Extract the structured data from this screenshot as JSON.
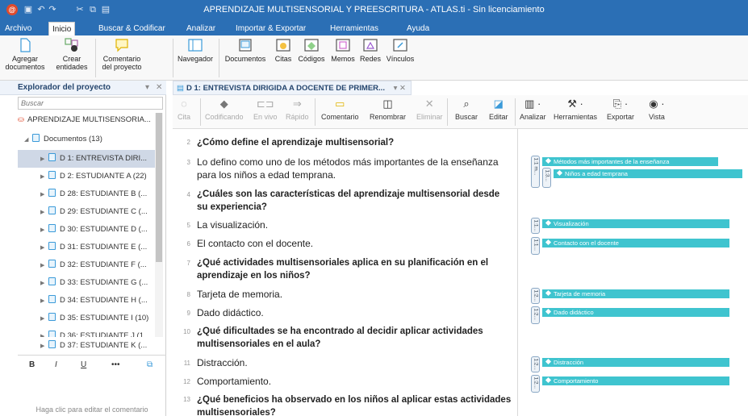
{
  "window": {
    "title": "APRENDIZAJE MULTISENSORIAL Y PREESCRITURA - ATLAS.ti - Sin licenciamiento"
  },
  "menu_tabs": [
    "Archivo",
    "Inicio",
    "Buscar & Codificar",
    "Analizar",
    "Importar & Exportar",
    "Herramientas",
    "Ayuda"
  ],
  "ribbon": {
    "add_docs": [
      "Agregar",
      "documentos"
    ],
    "create_entities": [
      "Crear",
      "entidades"
    ],
    "project_comment": [
      "Comentario",
      "del proyecto"
    ],
    "navigator": "Navegador",
    "documents": "Documentos",
    "quotes": "Citas",
    "codes": "Códigos",
    "memos": "Memos",
    "networks": "Redes",
    "links": "Vínculos"
  },
  "explorer": {
    "title": "Explorador del proyecto",
    "search_placeholder": "Buscar",
    "project": "APRENDIZAJE MULTISENSORIA...",
    "documents_group": "Documentos (13)",
    "items": [
      "D 1: ENTREVISTA DIRI...",
      "D 2: ESTUDIANTE A (22)",
      "D 28: ESTUDIANTE B (...",
      "D 29: ESTUDIANTE C (...",
      "D 30: ESTUDIANTE D (...",
      "D 31: ESTUDIANTE E (...",
      "D 32: ESTUDIANTE F (...",
      "D 33: ESTUDIANTE G (...",
      "D 34: ESTUDIANTE H (...",
      "D 35: ESTUDIANTE I (10)",
      "D 36: ESTUDIANTE J (1...",
      "D 37: ESTUDIANTE K (..."
    ],
    "format_bold": "B",
    "format_italic": "I",
    "format_underline": "U",
    "format_more": "•••",
    "comment_hint": "Haga clic para editar el comentario"
  },
  "doc_tab": {
    "title": "D 1: ENTREVISTA DIRIGIDA A DOCENTE DE PRIMER..."
  },
  "doc_toolbar": {
    "quote": "Cita",
    "coding": "Codificando",
    "live": "En vivo",
    "quick": "Rápido",
    "comment": "Comentario",
    "rename": "Renombrar",
    "delete": "Eliminar",
    "search": "Buscar",
    "edit": "Editar",
    "analyze": "Analizar",
    "tools": "Herramientas",
    "export": "Exportar",
    "view": "Vista"
  },
  "document_lines": [
    {
      "num": "2",
      "text": "¿Cómo define el aprendizaje multisensorial?"
    },
    {
      "num": "3",
      "text": "Lo defino como uno de los métodos más importantes de la enseñanza para los niños a edad temprana."
    },
    {
      "num": "4",
      "text": "¿Cuáles son las características del aprendizaje multisensorial desde su experiencia?"
    },
    {
      "num": "5",
      "text": "La visualización."
    },
    {
      "num": "6",
      "text": "El contacto con el docente."
    },
    {
      "num": "7",
      "text": "¿Qué actividades multisensoriales aplica en su planificación en el aprendizaje en los niños?"
    },
    {
      "num": "8",
      "text": "Tarjeta de memoria."
    },
    {
      "num": "9",
      "text": "Dado didáctico."
    },
    {
      "num": "10",
      "text": "¿Qué dificultades se ha encontrado al decidir aplicar actividades multisensoriales en el aula?"
    },
    {
      "num": "11",
      "text": "Distracción."
    },
    {
      "num": "12",
      "text": "Comportamiento."
    },
    {
      "num": "13",
      "text": "¿Qué beneficios ha observado en los niños al aplicar estas actividades multisensoriales?"
    }
  ],
  "quote_brackets": [
    "1:1 m...",
    "1:3...",
    "1:1...",
    "1:1...",
    "1:2...",
    "1:2...",
    "1:2...",
    "1:2..."
  ],
  "codes": [
    "Métodos más importantes de la enseñanza",
    "Niños a edad temprana",
    "Visualización",
    "Contacto con el docente",
    "Tarjeta de memoria",
    "Dado didáctico",
    "Distracción",
    "Comportamiento"
  ],
  "colors": {
    "title_bar": "#2b6fb5",
    "code_tag": "#3fc4cf",
    "selected_item": "#cfd8e6"
  }
}
